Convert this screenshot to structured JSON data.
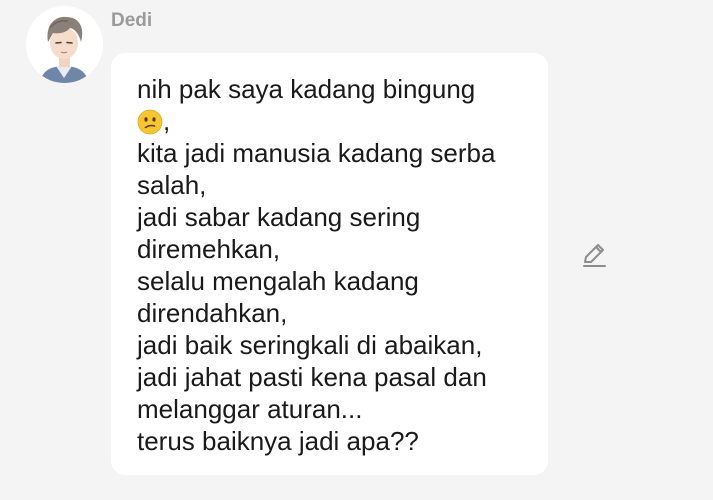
{
  "message": {
    "sender": "Dedi",
    "avatar_icon": "anime-character-avatar",
    "lines": [
      "nih pak saya kadang bingung",
      ",",
      "kita jadi manusia kadang serba",
      "salah,",
      "jadi sabar kadang sering",
      "diremehkan,",
      "selalu mengalah kadang",
      "direndahkan,",
      "jadi baik seringkali di abaikan,",
      "jadi jahat pasti kena pasal dan",
      "melanggar aturan...",
      "terus baiknya jadi apa??"
    ],
    "emoji": "confused-face-emoji"
  },
  "actions": {
    "edit_icon": "pencil-icon"
  },
  "colors": {
    "background": "#f4f4f4",
    "bubble": "#ffffff",
    "text": "#1a1a1a",
    "sender_name": "#9a9a9a",
    "icon": "#8c8c8c"
  }
}
